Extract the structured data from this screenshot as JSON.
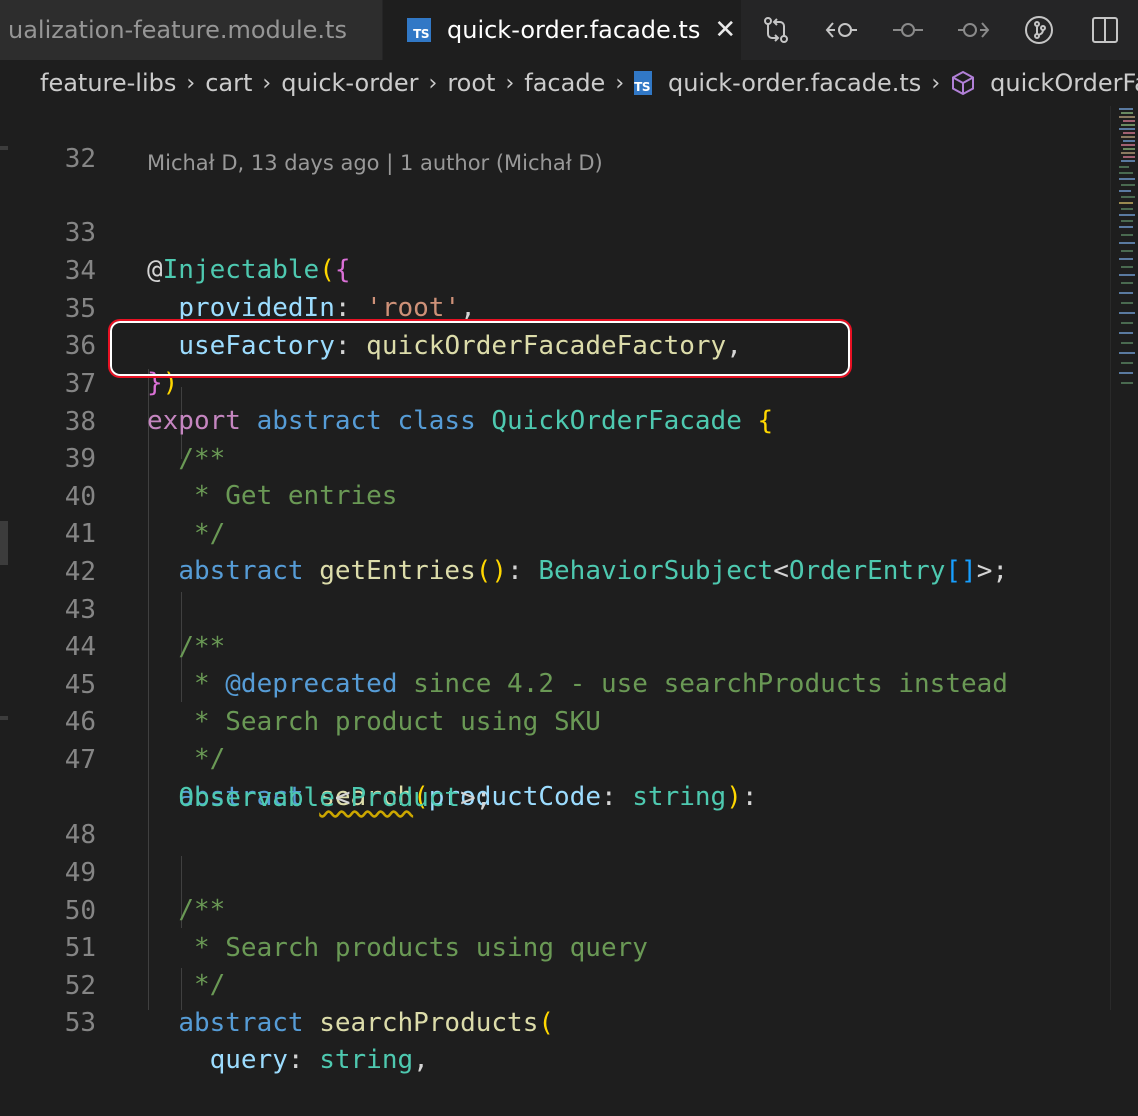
{
  "tabs": [
    {
      "label": "ualization-feature.module.ts",
      "active": false
    },
    {
      "label": "quick-order.facade.ts",
      "active": true,
      "icon": "ts-file-icon",
      "badge": "TS"
    }
  ],
  "tab_close_glyph": "✕",
  "actions": [
    "compare-changes-icon",
    "go-back-icon",
    "commit-icon",
    "go-forward-icon",
    "git-graph-icon",
    "split-editor-icon"
  ],
  "breadcrumb": {
    "items": [
      "feature-libs",
      "cart",
      "quick-order",
      "root",
      "facade"
    ],
    "file": "quick-order.facade.ts",
    "symbol": "quickOrderFac",
    "separator": "›",
    "badge": "TS"
  },
  "codelens": "Michał D, 13 days ago | 1 author (Michał D)",
  "colors": {
    "highlight_box": "#e81123",
    "background": "#1e1e1e",
    "keyword": "#569cd6",
    "type": "#4ec9b0",
    "comment": "#6a9955"
  },
  "line_numbers": {
    "l32": "32",
    "l33": "33",
    "l34": "34",
    "l35": "35",
    "l36": "36",
    "l37": "37",
    "l38": "38",
    "l39": "39",
    "l40": "40",
    "l41": "41",
    "l42": "42",
    "l43": "43",
    "l44": "44",
    "l45": "45",
    "l46": "46",
    "l47": "47",
    "l48": "48",
    "l49": "49",
    "l50": "50",
    "l51": "51",
    "l52": "52",
    "l53": "53"
  },
  "code": {
    "l33": {
      "at": "@",
      "decorator": "Injectable",
      "paren": "(",
      "brace": "{"
    },
    "l34": {
      "key": "providedIn",
      "colon": ": ",
      "value": "'root'",
      "comma": ","
    },
    "l35": {
      "key": "useFactory",
      "colon": ": ",
      "value": "quickOrderFacadeFactory",
      "comma": ","
    },
    "l36": {
      "brace": "}",
      "paren": ")"
    },
    "l37": {
      "kw_export": "export",
      "kw_abstract": "abstract",
      "kw_class": "class",
      "name": "QuickOrderFacade",
      "brace": "{"
    },
    "l38": "/**",
    "l39": " * Get entries",
    "l40": " */",
    "l41": {
      "kw": "abstract",
      "fn": "getEntries",
      "parens": "()",
      "colon": ": ",
      "type": "BehaviorSubject",
      "lt": "<",
      "type2": "OrderEntry",
      "brackets": "[]",
      "end": ">;"
    },
    "l43": "/**",
    "l44": {
      "star": " * ",
      "tag": "@deprecated",
      "text": " since 4.2 - use searchProducts instead"
    },
    "l45": " * Search product using SKU",
    "l46": " */",
    "l47": {
      "kw": "abstract",
      "fn": "search",
      "open": "(",
      "param": "productCode",
      "colon": ": ",
      "ptype": "string",
      "close": ")",
      "colon2": ":"
    },
    "l47b": {
      "type": "Observable",
      "lt": "<",
      "type2": "Product",
      "end": ">;"
    },
    "l49": "/**",
    "l50": " * Search products using query",
    "l51": " */",
    "l52": {
      "kw": "abstract",
      "fn": "searchProducts",
      "open": "("
    },
    "l53": {
      "param": "query",
      "colon": ": ",
      "ptype": "string",
      "comma": ","
    }
  }
}
